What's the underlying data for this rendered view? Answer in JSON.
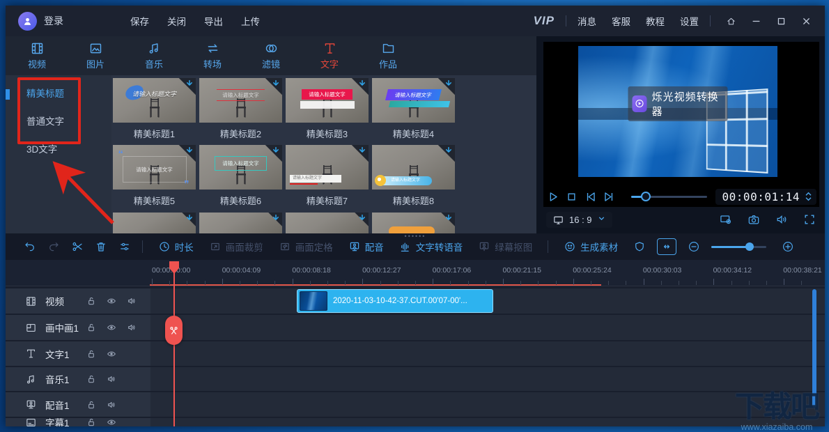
{
  "titlebar": {
    "login": "登录",
    "menu": [
      "保存",
      "关闭",
      "导出",
      "上传"
    ],
    "vip": "VIP",
    "right_menu": [
      "消息",
      "客服",
      "教程",
      "设置"
    ]
  },
  "tabs": [
    {
      "id": "video",
      "label": "视频",
      "icon": "film-icon"
    },
    {
      "id": "image",
      "label": "图片",
      "icon": "image-icon"
    },
    {
      "id": "music",
      "label": "音乐",
      "icon": "music-icon"
    },
    {
      "id": "transition",
      "label": "转场",
      "icon": "transition-icon"
    },
    {
      "id": "filter",
      "label": "滤镜",
      "icon": "filter-icon"
    },
    {
      "id": "text",
      "label": "文字",
      "icon": "text-icon",
      "active": true
    },
    {
      "id": "works",
      "label": "作品",
      "icon": "folder-icon"
    }
  ],
  "sidebar": {
    "items": [
      {
        "id": "beautiful-title",
        "label": "精美标题",
        "active": true
      },
      {
        "id": "plain-text",
        "label": "普通文字"
      },
      {
        "id": "3d-text",
        "label": "3D文字"
      }
    ]
  },
  "templates": {
    "placeholder": "请输入标题文字",
    "items": [
      {
        "name": "精美标题1"
      },
      {
        "name": "精美标题2"
      },
      {
        "name": "精美标题3"
      },
      {
        "name": "精美标题4"
      },
      {
        "name": "精美标题5"
      },
      {
        "name": "精美标题6"
      },
      {
        "name": "精美标题7"
      },
      {
        "name": "精美标题8"
      }
    ]
  },
  "preview": {
    "banner": "烁光视频转换器",
    "timecode": "00:00:01:14",
    "aspect": "16 : 9"
  },
  "toolbar": {
    "duration_label": "时长",
    "crop_label": "画面裁剪",
    "freeze_label": "画面定格",
    "dub_label": "配音",
    "tts_label": "文字转语音",
    "green_label": "绿幕抠图",
    "generate_label": "生成素材"
  },
  "timeline": {
    "ruler": [
      "00:00:00:00",
      "00:00:04:09",
      "00:00:08:18",
      "00:00:12:27",
      "00:00:17:06",
      "00:00:21:15",
      "00:00:25:24",
      "00:00:30:03",
      "00:00:34:12",
      "00:00:38:21"
    ],
    "clip": {
      "name": "2020-11-03-10-42-37.CUT.00'07-00'..."
    },
    "tracks": [
      {
        "id": "video",
        "label": "视频",
        "icon": "film-icon",
        "controls": [
          "lock",
          "eye",
          "speaker"
        ]
      },
      {
        "id": "pip",
        "label": "画中画1",
        "icon": "pip-icon",
        "controls": [
          "lock",
          "eye",
          "speaker"
        ]
      },
      {
        "id": "text",
        "label": "文字1",
        "icon": "text-icon",
        "controls": [
          "lock",
          "eye"
        ]
      },
      {
        "id": "music",
        "label": "音乐1",
        "icon": "music-icon",
        "controls": [
          "lock",
          "speaker"
        ]
      },
      {
        "id": "voice",
        "label": "配音1",
        "icon": "voice-icon",
        "controls": [
          "lock",
          "speaker"
        ]
      },
      {
        "id": "subtitle",
        "label": "字幕1",
        "icon": "subtitle-icon",
        "controls": [
          "lock",
          "eye"
        ],
        "partial": true
      }
    ]
  },
  "watermark": {
    "title": "下载吧",
    "url": "www.xiazaiba.com"
  },
  "colors": {
    "accent": "#4ba5ec",
    "tab_active_red": "#e6473a",
    "annotation_red": "#e1251b",
    "clip_blue": "#2db3ef",
    "playhead_red": "#ef5350"
  }
}
